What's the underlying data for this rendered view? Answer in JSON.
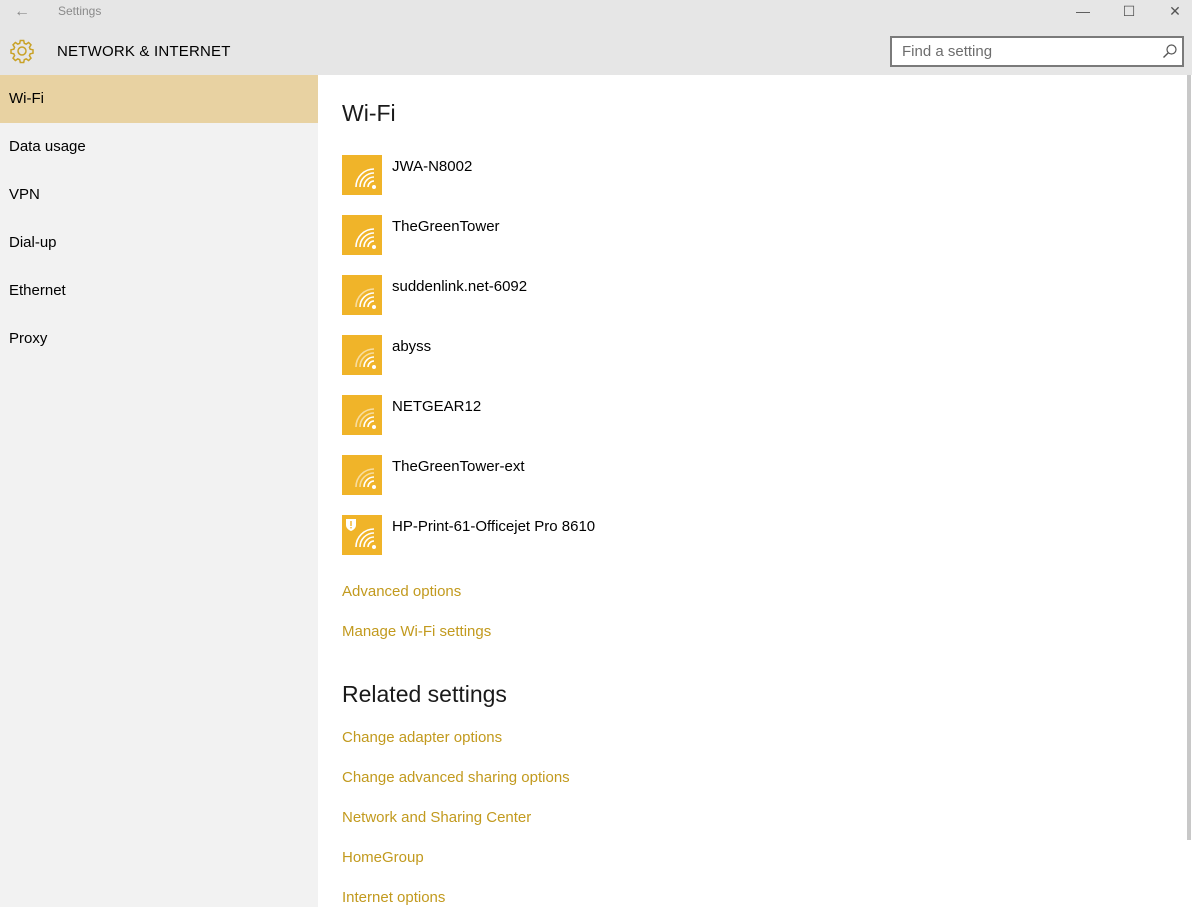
{
  "window": {
    "app_title": "Settings",
    "back_glyph": "←",
    "minimize_glyph": "—",
    "maximize_glyph": "☐",
    "close_glyph": "✕"
  },
  "header": {
    "title": "NETWORK & INTERNET",
    "icon": "gear-icon",
    "search": {
      "placeholder": "Find a setting",
      "value": ""
    }
  },
  "sidebar": {
    "items": [
      {
        "label": "Wi-Fi",
        "active": true
      },
      {
        "label": "Data usage",
        "active": false
      },
      {
        "label": "VPN",
        "active": false
      },
      {
        "label": "Dial-up",
        "active": false
      },
      {
        "label": "Ethernet",
        "active": false
      },
      {
        "label": "Proxy",
        "active": false
      }
    ]
  },
  "main": {
    "wifi_title": "Wi-Fi",
    "networks": [
      {
        "name": "JWA-N8002",
        "icon": "wifi-icon",
        "secured_warning": false
      },
      {
        "name": "TheGreenTower",
        "icon": "wifi-icon",
        "secured_warning": false
      },
      {
        "name": "suddenlink.net-6092",
        "icon": "wifi-icon",
        "secured_warning": false
      },
      {
        "name": "abyss",
        "icon": "wifi-icon",
        "secured_warning": false
      },
      {
        "name": "NETGEAR12",
        "icon": "wifi-icon",
        "secured_warning": false
      },
      {
        "name": "TheGreenTower-ext",
        "icon": "wifi-icon",
        "secured_warning": false
      },
      {
        "name": "HP-Print-61-Officejet Pro 8610",
        "icon": "wifi-icon",
        "secured_warning": true
      }
    ],
    "advanced_options": "Advanced options",
    "manage_wifi": "Manage Wi-Fi settings",
    "related_title": "Related settings",
    "related_links": [
      "Change adapter options",
      "Change advanced sharing options",
      "Network and Sharing Center",
      "HomeGroup",
      "Internet options"
    ]
  },
  "colors": {
    "accent": "#f0b429",
    "link": "#c29a1e",
    "active_nav": "#e8d2a2",
    "chrome": "#e6e6e6",
    "sidebar_bg": "#f2f2f2"
  }
}
